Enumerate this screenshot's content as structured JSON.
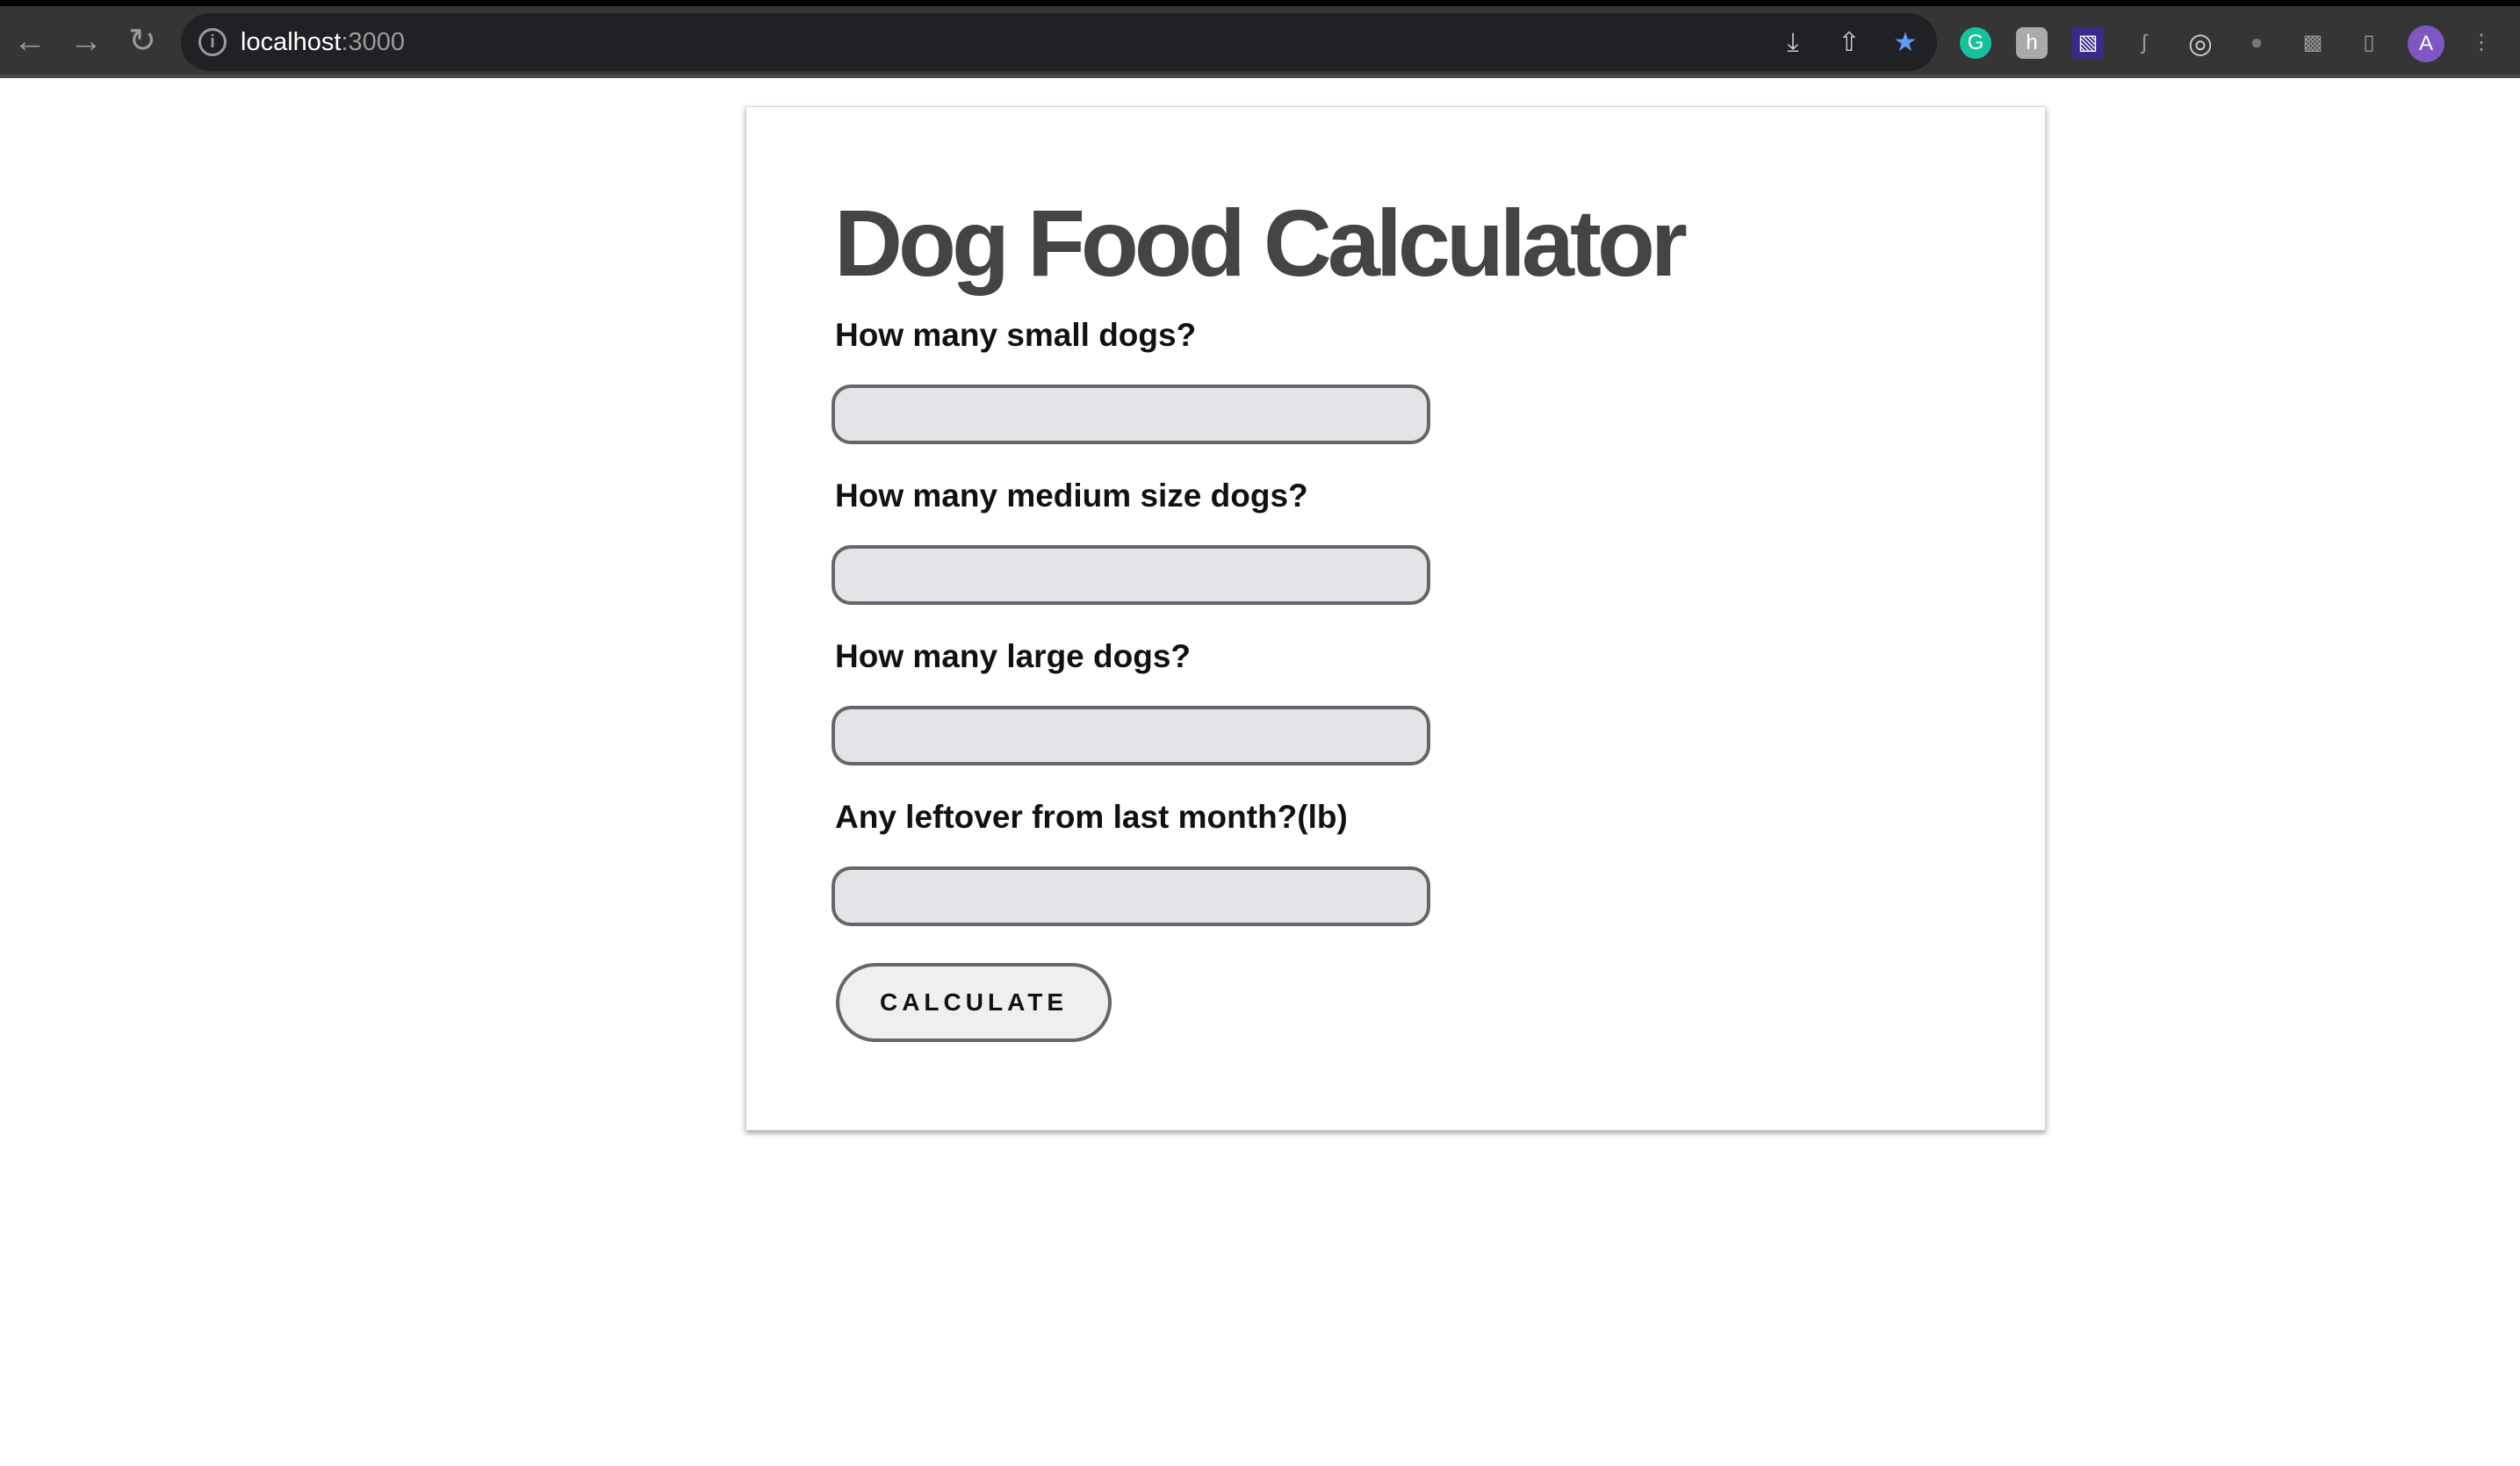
{
  "browser": {
    "url_host": "localhost",
    "url_port": ":3000",
    "icons": [
      "back-icon",
      "forward-icon",
      "reload-icon",
      "info-icon",
      "install-icon",
      "share-icon",
      "bookmark-star-icon",
      "grammarly-extension-icon",
      "h-extension-icon",
      "purple-extension-icon",
      "s-extension-icon",
      "target-extension-icon",
      "bug-extension-icon",
      "extensions-puzzle-icon",
      "side-panel-icon",
      "profile-avatar",
      "menu-kebab-icon"
    ],
    "profile_initial": "A",
    "colors": {
      "toolbar": "#353535",
      "omnibox": "#202124",
      "star": "#5b9cf6",
      "avatar": "#7e57c2"
    }
  },
  "page": {
    "title": "Dog Food Calculator",
    "fields": [
      {
        "label": "How many small dogs?",
        "value": ""
      },
      {
        "label": "How many medium size dogs?",
        "value": ""
      },
      {
        "label": "How many large dogs?",
        "value": ""
      },
      {
        "label": "Any leftover from last month?(lb)",
        "value": ""
      }
    ],
    "calculate_label": "CALCULATE"
  }
}
